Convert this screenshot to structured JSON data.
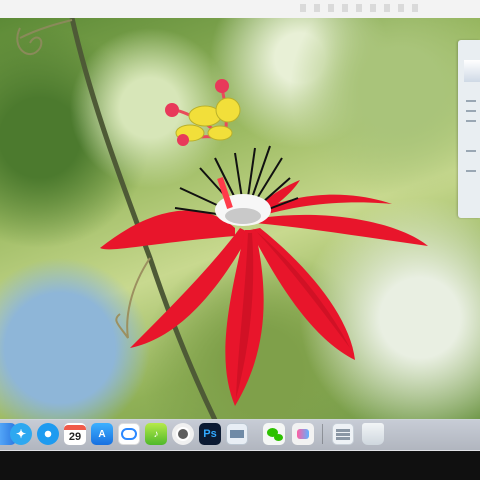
{
  "wallpaper": {
    "subject": "red-passion-flower"
  },
  "dock": {
    "items": [
      {
        "name": "finder",
        "label": "",
        "color": "#3f8fe8"
      },
      {
        "name": "qq-browser",
        "label": "",
        "color": "#2ea8f0"
      },
      {
        "name": "safari",
        "label": "",
        "color": "#1e9bf0"
      },
      {
        "name": "calendar",
        "label": "29",
        "color": "#ffffff"
      },
      {
        "name": "app-store",
        "label": "",
        "color": "#1c8cf0"
      },
      {
        "name": "baidu-netdisk",
        "label": "",
        "color": "#ffffff"
      },
      {
        "name": "music",
        "label": "",
        "color": "#8ed23b"
      },
      {
        "name": "chrome-app",
        "label": "",
        "color": "#f0f0f0"
      },
      {
        "name": "photoshop",
        "label": "Ps",
        "color": "#0c1b33"
      },
      {
        "name": "preview",
        "label": "",
        "color": "#e8eef5"
      },
      {
        "name": "wechat",
        "label": "",
        "color": "#2dc100"
      },
      {
        "name": "chat-app",
        "label": "",
        "color": "#f2f2f2"
      },
      {
        "name": "downloads",
        "label": "",
        "color": "#eef2f6"
      },
      {
        "name": "trash",
        "label": "",
        "color": "#dfe5ea"
      }
    ]
  }
}
